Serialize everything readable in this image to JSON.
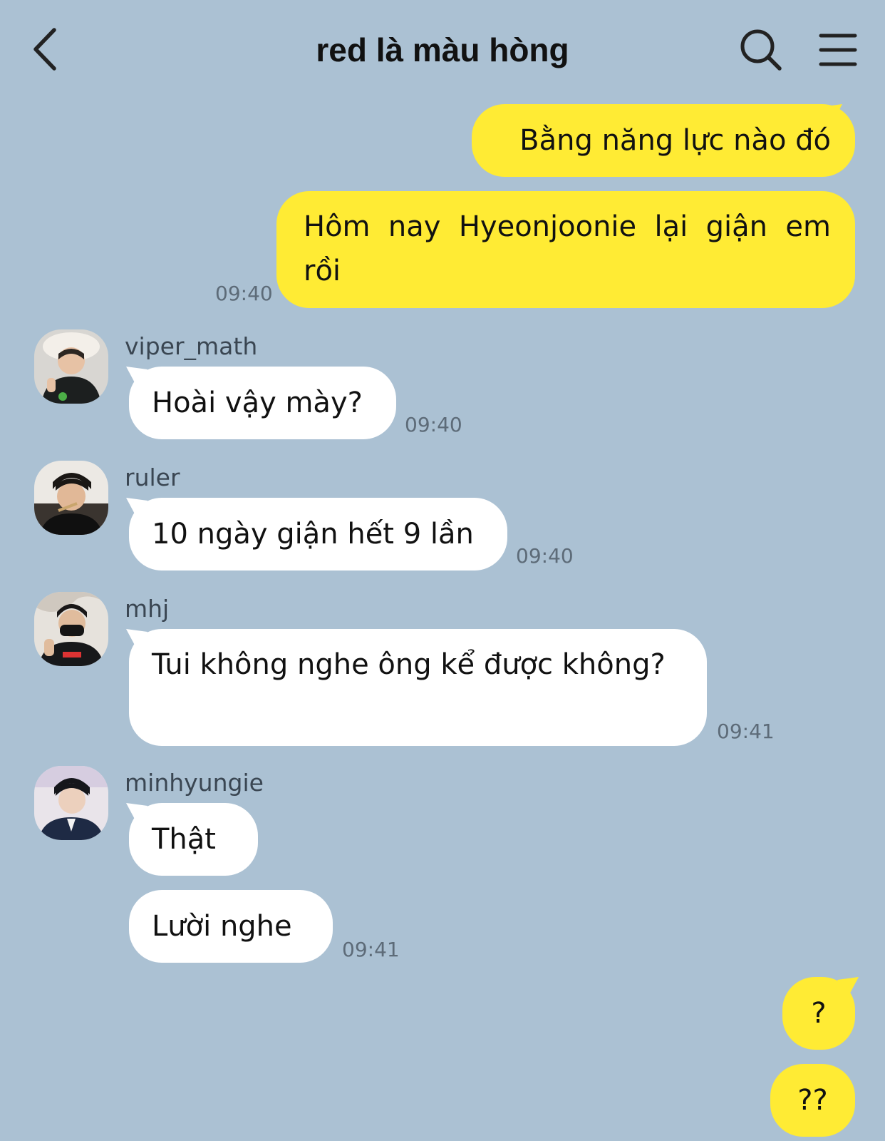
{
  "header": {
    "title": "red là màu hòng",
    "back_icon": "chevron-left-icon",
    "search_icon": "search-icon",
    "menu_icon": "hamburger-menu-icon"
  },
  "colors": {
    "background": "#abc1d3",
    "my_bubble": "#ffeb34",
    "their_bubble": "#ffffff",
    "timestamp": "#5d6b78"
  },
  "messages": {
    "m1": {
      "text": "Bằng năng lực nào đó"
    },
    "m2": {
      "text": "Hôm nay Hyeonjoonie lại giận em rồi",
      "time": "09:40"
    },
    "m3": {
      "sender": "viper_math",
      "text": "Hoài vậy mày?",
      "time": "09:40"
    },
    "m4": {
      "sender": "ruler",
      "text": "10 ngày giận hết 9 lần",
      "time": "09:40"
    },
    "m5": {
      "sender": "mhj",
      "text": "Tui không nghe ông kể được không?",
      "time": "09:41"
    },
    "m6": {
      "sender": "minhyungie",
      "text": "Thật"
    },
    "m7": {
      "text": "Lười nghe",
      "time": "09:41"
    },
    "m8": {
      "text": "?"
    },
    "m9": {
      "text": "??"
    }
  }
}
